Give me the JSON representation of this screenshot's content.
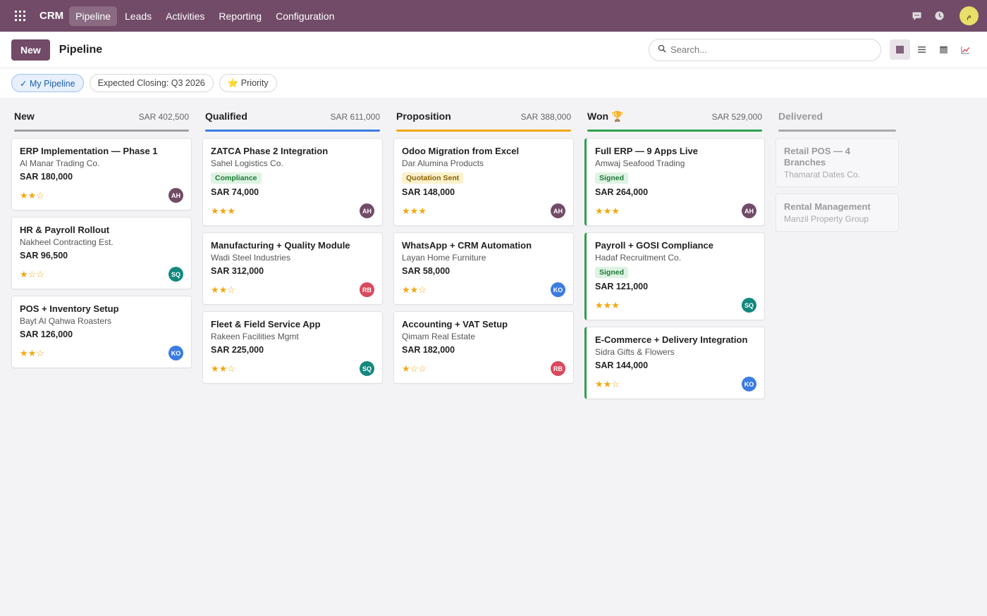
{
  "navbar": {
    "app_name": "CRM",
    "menu": [
      {
        "label": "Pipeline",
        "active": true
      },
      {
        "label": "Leads"
      },
      {
        "label": "Activities"
      },
      {
        "label": "Reporting"
      },
      {
        "label": "Configuration"
      }
    ],
    "user_initial": "م",
    "color": "#714b67"
  },
  "control": {
    "new_label": "New",
    "title": "Pipeline",
    "search_placeholder": "Search...",
    "views": [
      {
        "name": "kanban-icon",
        "active": true
      },
      {
        "name": "list-icon"
      },
      {
        "name": "calendar-icon"
      },
      {
        "name": "graph-icon"
      }
    ]
  },
  "filters": [
    {
      "label": "✓ My Pipeline",
      "active": true
    },
    {
      "label": "Expected Closing: Q3 2026"
    },
    {
      "label": "⭐ Priority"
    }
  ],
  "columns": [
    {
      "title": "New",
      "total": "SAR 402,500",
      "color": "#9e9ea4",
      "cards": [
        {
          "title": "ERP Implementation — Phase 1",
          "company": "Al Manar Trading Co.",
          "amount": "SAR 180,000",
          "stars": "★★☆",
          "avatar": "AH",
          "avatar_color": "#714b67"
        },
        {
          "title": "HR & Payroll Rollout",
          "company": "Nakheel Contracting Est.",
          "amount": "SAR 96,500",
          "stars": "★☆☆",
          "avatar": "SQ",
          "avatar_color": "#13887e"
        },
        {
          "title": "POS + Inventory Setup",
          "company": "Bayt Al Qahwa Roasters",
          "amount": "SAR 126,000",
          "stars": "★★☆",
          "avatar": "KO",
          "avatar_color": "#3b7ce0"
        }
      ]
    },
    {
      "title": "Qualified",
      "total": "SAR 611,000",
      "color": "#3b7ce0",
      "cards": [
        {
          "title": "ZATCA Phase 2 Integration",
          "company": "Sahel Logistics Co.",
          "tag": "Compliance",
          "tag_style": "green",
          "amount": "SAR 74,000",
          "stars": "★★★",
          "avatar": "AH",
          "avatar_color": "#714b67"
        },
        {
          "title": "Manufacturing + Quality Module",
          "company": "Wadi Steel Industries",
          "amount": "SAR 312,000",
          "stars": "★★☆",
          "avatar": "RB",
          "avatar_color": "#d9495c"
        },
        {
          "title": "Fleet & Field Service App",
          "company": "Rakeen Facilities Mgmt",
          "amount": "SAR 225,000",
          "stars": "★★☆",
          "avatar": "SQ",
          "avatar_color": "#13887e"
        }
      ]
    },
    {
      "title": "Proposition",
      "total": "SAR 388,000",
      "color": "#f3a712",
      "cards": [
        {
          "title": "Odoo Migration from Excel",
          "company": "Dar Alumina Products",
          "tag": "Quotation Sent",
          "tag_style": "yellow",
          "amount": "SAR 148,000",
          "stars": "★★★",
          "avatar": "AH",
          "avatar_color": "#714b67"
        },
        {
          "title": "WhatsApp + CRM Automation",
          "company": "Layan Home Furniture",
          "amount": "SAR 58,000",
          "stars": "★★☆",
          "avatar": "KO",
          "avatar_color": "#3b7ce0"
        },
        {
          "title": "Accounting + VAT Setup",
          "company": "Qimam Real Estate",
          "amount": "SAR 182,000",
          "stars": "★☆☆",
          "avatar": "RB",
          "avatar_color": "#d9495c"
        }
      ]
    },
    {
      "title": "Won 🏆",
      "total": "SAR 529,000",
      "color": "#2ba14b",
      "cards": [
        {
          "title": "Full ERP — 9 Apps Live",
          "company": "Amwaj Seafood Trading",
          "tag": "Signed",
          "tag_style": "green",
          "amount": "SAR 264,000",
          "stars": "★★★",
          "avatar": "AH",
          "avatar_color": "#714b67"
        },
        {
          "title": "Payroll + GOSI Compliance",
          "company": "Hadaf Recruitment Co.",
          "tag": "Signed",
          "tag_style": "green",
          "amount": "SAR 121,000",
          "stars": "★★★",
          "avatar": "SQ",
          "avatar_color": "#13887e"
        },
        {
          "title": "E-Commerce + Delivery Integration",
          "company": "Sidra Gifts & Flowers",
          "amount": "SAR 144,000",
          "stars": "★★☆",
          "avatar": "KO",
          "avatar_color": "#3b7ce0"
        }
      ]
    },
    {
      "title": "Delivered",
      "color": "#a8a8ae",
      "cards": [
        {
          "title": "Retail POS — 4 Branches",
          "company": "Thamarat Dates Co."
        },
        {
          "title": "Rental Management",
          "company": "Manzil Property Group"
        }
      ]
    }
  ]
}
